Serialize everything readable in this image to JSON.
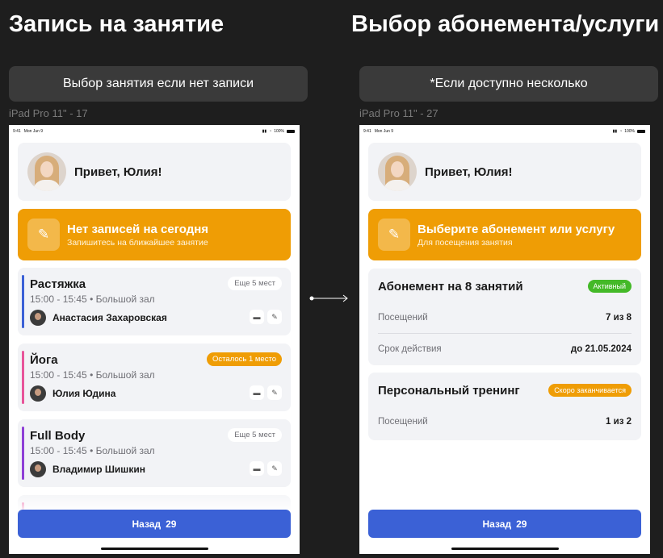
{
  "left": {
    "section_title": "Запись на занятие",
    "note_button": "Выбор занятия если нет записи",
    "frame_label": "iPad Pro 11\" - 17",
    "status": {
      "time": "9:41",
      "date": "Mon Jun 9",
      "battery": "100%"
    },
    "greeting": "Привет, Юлия!",
    "banner": {
      "title": "Нет записей на сегодня",
      "subtitle": "Запишитесь на ближайшее занятие",
      "icon": "pencil-icon"
    },
    "lessons": [
      {
        "title": "Растяжка",
        "time": "15:00 - 15:45",
        "room": "Большой зал",
        "coach": "Анастасия Захаровская",
        "badge": "Еще 5 мест",
        "badge_style": "plain",
        "color": "#3b61d6"
      },
      {
        "title": "Йога",
        "time": "15:00 - 15:45",
        "room": "Большой зал",
        "coach": "Юлия Юдина",
        "badge": "Осталось 1 место",
        "badge_style": "orange",
        "color": "#e8549a"
      },
      {
        "title": "Full Body",
        "time": "15:00 - 15:45",
        "room": "Большой зал",
        "coach": "Владимир Шишкин",
        "badge": "Еще 5 мест",
        "badge_style": "plain",
        "color": "#8e3fd6"
      }
    ],
    "separator": "•",
    "back_button": {
      "label": "Назад",
      "count": "29"
    }
  },
  "right": {
    "section_title": "Выбор абонемента/услуги",
    "note_button": "*Если доступно несколько",
    "frame_label": "iPad Pro 11\" - 27",
    "status": {
      "time": "9:41",
      "date": "Mon Jun 9",
      "battery": "100%"
    },
    "greeting": "Привет, Юлия!",
    "banner": {
      "title": "Выберите абонемент или услугу",
      "subtitle": "Для посещения занятия",
      "icon": "pencil-icon"
    },
    "subscriptions": [
      {
        "name": "Абонемент на 8 занятий",
        "status": "Активный",
        "status_color": "#44b928",
        "rows": [
          {
            "label": "Посещений",
            "value": "7 из 8"
          },
          {
            "label": "Срок действия",
            "value": "до 21.05.2024"
          }
        ]
      },
      {
        "name": "Персональный тренинг",
        "status": "Скоро заканчивается",
        "status_color": "#ef9d05",
        "rows": [
          {
            "label": "Посещений",
            "value": "1 из 2"
          }
        ]
      }
    ],
    "back_button": {
      "label": "Назад",
      "count": "29"
    }
  },
  "colors": {
    "accent_blue": "#3b61d6",
    "accent_orange": "#ef9d05",
    "active_green": "#44b928",
    "canvas_bg": "#1e1e1e"
  }
}
